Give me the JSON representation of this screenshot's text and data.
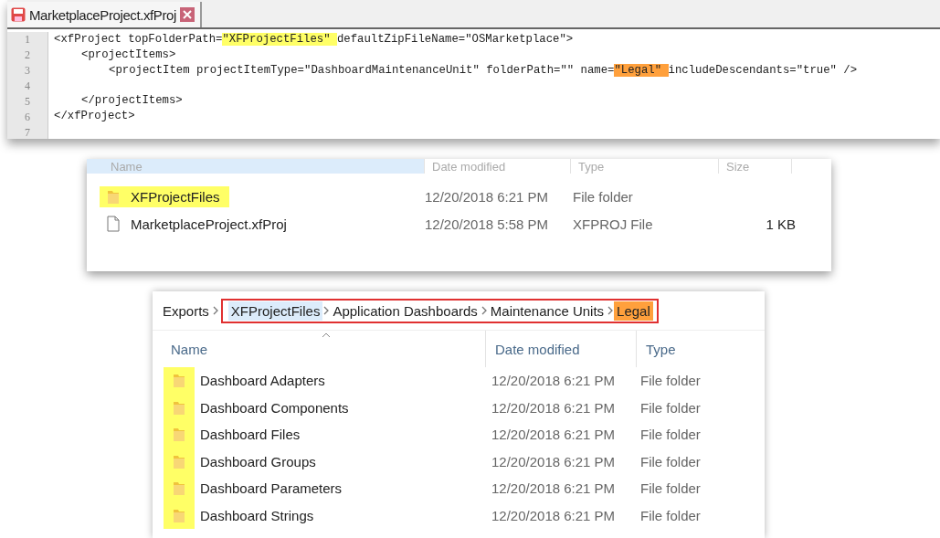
{
  "editor": {
    "tab": {
      "title": "MarketplaceProject.xfProj"
    },
    "lines": [
      {
        "number": "1",
        "segments": [
          {
            "text": "<xfProject topFolderPath="
          },
          {
            "text": "\"XFProjectFiles\" ",
            "color": "#ffff66"
          },
          {
            "text": "defaultZipFileName=\"OSMarketplace\">"
          }
        ],
        "children": [
          {
            "number": "2",
            "segments": [
              {
                "text": "<projectItems>"
              }
            ],
            "children": [
              {
                "number": "3",
                "segments": [
                  {
                    "text": "<projectItem projectItemType=\"DashboardMaintenanceUnit\" folderPath=\"\" name="
                  },
                  {
                    "text": "\"Legal\" ",
                    "color": "#ffa03c"
                  },
                  {
                    "text": "includeDescendants=\"true\" />"
                  }
                ]
              },
              {
                "number": "4"
              }
            ]
          },
          {
            "number": "5",
            "segments": [
              {
                "text": "</projectItems>"
              }
            ]
          }
        ]
      },
      {
        "number": "6",
        "segments": [
          {
            "text": "</xfProject>"
          }
        ]
      },
      {
        "number": "7"
      }
    ]
  },
  "explorer_top": {
    "columns": [
      "Name",
      "Date modified",
      "Type",
      "Size"
    ],
    "rows": [
      {
        "kind": "folder",
        "name": "XFProjectFiles",
        "date": "12/20/2018 6:21 PM",
        "type": "File folder",
        "highlighted": true
      },
      {
        "kind": "file",
        "name": "MarketplaceProject.xfProj",
        "date": "12/20/2018 5:58 PM",
        "type": "XFPROJ File",
        "size": "1 KB",
        "highlighted": false
      }
    ]
  },
  "explorer_bottom": {
    "breadcrumb": [
      {
        "label": "Exports",
        "outlined": false
      },
      {
        "label": "XFProjectFiles",
        "outlined": true,
        "color": "#dcecfb"
      },
      {
        "label": "Application Dashboards",
        "outlined": true
      },
      {
        "label": "Maintenance Units",
        "outlined": true
      },
      {
        "label": "Legal",
        "outlined": true,
        "color": "#ffa03c"
      }
    ],
    "columns": [
      "Name",
      "Date modified",
      "Type"
    ],
    "icons_highlighted": true,
    "rows": [
      {
        "kind": "folder",
        "name": "Dashboard Adapters",
        "date": "12/20/2018 6:21 PM",
        "type": "File folder"
      },
      {
        "kind": "folder",
        "name": "Dashboard Components",
        "date": "12/20/2018 6:21 PM",
        "type": "File folder"
      },
      {
        "kind": "folder",
        "name": "Dashboard Files",
        "date": "12/20/2018 6:21 PM",
        "type": "File folder"
      },
      {
        "kind": "folder",
        "name": "Dashboard Groups",
        "date": "12/20/2018 6:21 PM",
        "type": "File folder"
      },
      {
        "kind": "folder",
        "name": "Dashboard Parameters",
        "date": "12/20/2018 6:21 PM",
        "type": "File folder"
      },
      {
        "kind": "folder",
        "name": "Dashboard Strings",
        "date": "12/20/2018 6:21 PM",
        "type": "File folder"
      }
    ]
  }
}
